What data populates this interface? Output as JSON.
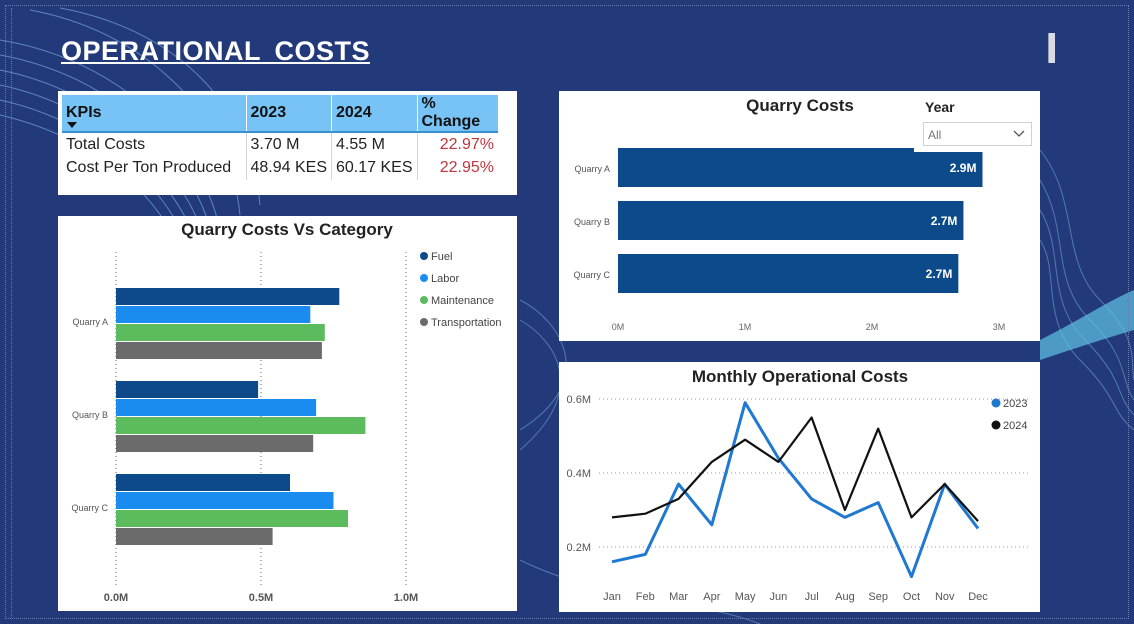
{
  "page": {
    "title": "OPERATIONAL  COSTS"
  },
  "colors": {
    "background": "#233a7a",
    "fuel": "#0c4a8a",
    "labor": "#1a8cf0",
    "maintenance": "#5cbb5c",
    "transportation": "#6b6b6b",
    "line_2023": "#1f78d1",
    "line_2024": "#111111",
    "negative_change": "#c0353d"
  },
  "kpi_table": {
    "headers": [
      "KPIs",
      "2023",
      "2024",
      "% Change"
    ],
    "rows": [
      [
        "Total Costs",
        "3.70 M",
        "4.55 M",
        "22.97%"
      ],
      [
        "Cost Per Ton Produced",
        "48.94 KES",
        "60.17 KES",
        "22.95%"
      ]
    ]
  },
  "year_slicer": {
    "label": "Year",
    "value": "All"
  },
  "chart_data": [
    {
      "id": "quarry_costs_vs_category",
      "type": "bar",
      "orientation": "horizontal",
      "title": "Quarry Costs Vs Category",
      "categories": [
        "Quarry A",
        "Quarry B",
        "Quarry C"
      ],
      "series": [
        {
          "name": "Fuel",
          "values": [
            0.77,
            0.49,
            0.6
          ]
        },
        {
          "name": "Labor",
          "values": [
            0.67,
            0.69,
            0.75
          ]
        },
        {
          "name": "Maintenance",
          "values": [
            0.72,
            0.86,
            0.8
          ]
        },
        {
          "name": "Transportation",
          "values": [
            0.71,
            0.68,
            0.54
          ]
        }
      ],
      "x_ticks": [
        "0.0M",
        "0.5M",
        "1.0M"
      ],
      "xlim": [
        0,
        1.0
      ],
      "legend": "right",
      "grid": "vertical-dotted"
    },
    {
      "id": "quarry_costs",
      "type": "bar",
      "orientation": "horizontal",
      "title": "Quarry Costs",
      "categories": [
        "Quarry A",
        "Quarry B",
        "Quarry C"
      ],
      "values": [
        2.87,
        2.72,
        2.68
      ],
      "data_labels": [
        "2.9M",
        "2.7M",
        "2.7M"
      ],
      "x_ticks": [
        "0M",
        "1M",
        "2M",
        "3M"
      ],
      "xlim": [
        0,
        3
      ]
    },
    {
      "id": "monthly_operational_costs",
      "type": "line",
      "title": "Monthly Operational Costs",
      "x": [
        "Jan",
        "Feb",
        "Mar",
        "Apr",
        "May",
        "Jun",
        "Jul",
        "Aug",
        "Sep",
        "Oct",
        "Nov",
        "Dec"
      ],
      "series": [
        {
          "name": "2023",
          "values": [
            0.16,
            0.18,
            0.37,
            0.26,
            0.59,
            0.44,
            0.33,
            0.28,
            0.32,
            0.12,
            0.37,
            0.25
          ]
        },
        {
          "name": "2024",
          "values": [
            0.28,
            0.29,
            0.33,
            0.43,
            0.49,
            0.43,
            0.55,
            0.3,
            0.52,
            0.28,
            0.37,
            0.27
          ]
        }
      ],
      "y_ticks": [
        "0.2M",
        "0.4M",
        "0.6M"
      ],
      "ylim": [
        0.1,
        0.65
      ],
      "legend": "top-right",
      "grid": "horizontal-dotted"
    }
  ]
}
